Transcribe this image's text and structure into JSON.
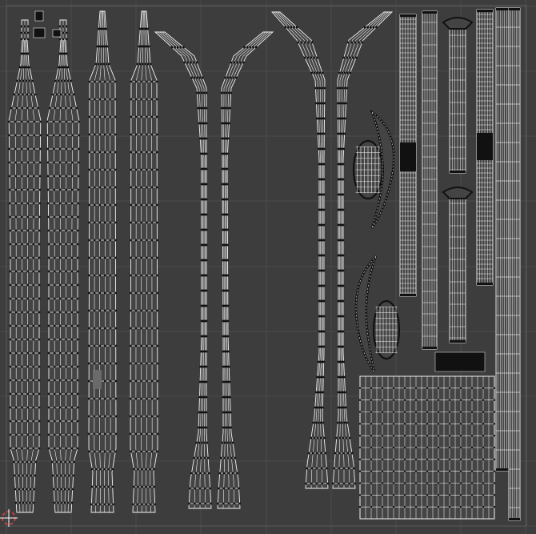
{
  "editor": {
    "background": "#3d3d3d",
    "grid_color": "#4a4a4a",
    "frame_color": "#5a5a5a",
    "wire_color": "#f2f2f2",
    "seam_color": "#111111",
    "face_fill": "#444444",
    "selected_face_fill": "#6a6a6a",
    "cursor_color_a": "#e04040",
    "cursor_color_b": "#ffffff"
  },
  "icons": {
    "cursor": "3d-cursor-icon"
  }
}
